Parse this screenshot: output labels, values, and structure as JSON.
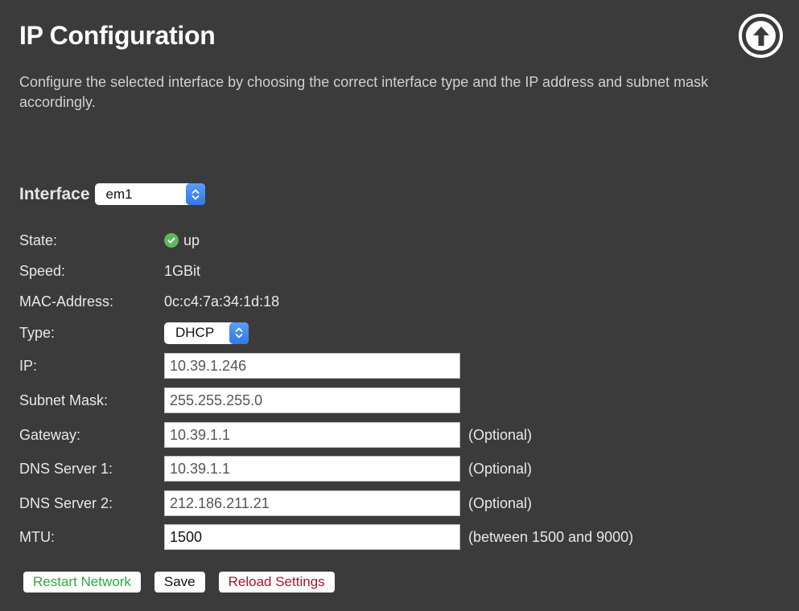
{
  "page": {
    "title": "IP Configuration",
    "description": "Configure the selected interface by choosing the correct interface type and the IP address and subnet mask accordingly."
  },
  "interface": {
    "label": "Interface",
    "selected": "em1"
  },
  "info": {
    "state_label": "State:",
    "state_value": "up",
    "speed_label": "Speed:",
    "speed_value": "1GBit",
    "mac_label": "MAC-Address:",
    "mac_value": "0c:c4:7a:34:1d:18",
    "type_label": "Type:",
    "type_value": "DHCP"
  },
  "fields": {
    "ip": {
      "label": "IP:",
      "value": "10.39.1.246"
    },
    "subnet": {
      "label": "Subnet Mask:",
      "value": "255.255.255.0"
    },
    "gateway": {
      "label": "Gateway:",
      "value": "10.39.1.1",
      "hint": "(Optional)"
    },
    "dns1": {
      "label": "DNS Server 1:",
      "value": "10.39.1.1",
      "hint": "(Optional)"
    },
    "dns2": {
      "label": "DNS Server 2:",
      "value": "212.186.211.21",
      "hint": "(Optional)"
    },
    "mtu": {
      "label": "MTU:",
      "value": "1500",
      "hint": "(between 1500 and 9000)"
    }
  },
  "buttons": {
    "restart": "Restart Network",
    "save": "Save",
    "reload": "Reload Settings"
  },
  "colors": {
    "background": "#3b3b3b",
    "restart_text": "#2eaa3a",
    "save_text": "#111111",
    "reload_text": "#b0102a",
    "status_ok": "#5cb85c",
    "select_accent": "#3a85ee"
  },
  "icons": {
    "top": "arrow-up-circle-icon",
    "state": "check-circle-icon",
    "select": "chevron-updown-icon"
  }
}
